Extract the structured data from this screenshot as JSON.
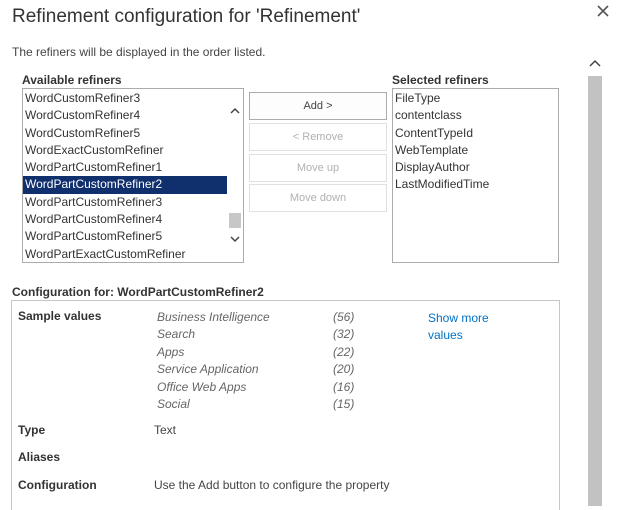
{
  "dialog": {
    "title": "Refinement configuration for 'Refinement'",
    "intro": "The refiners will be displayed in the order listed."
  },
  "available": {
    "label": "Available refiners",
    "items": [
      "WordCustomRefiner3",
      "WordCustomRefiner4",
      "WordCustomRefiner5",
      "WordExactCustomRefiner",
      "WordPartCustomRefiner1",
      "WordPartCustomRefiner2",
      "WordPartCustomRefiner3",
      "WordPartCustomRefiner4",
      "WordPartCustomRefiner5",
      "WordPartExactCustomRefiner"
    ],
    "selected": "WordPartCustomRefiner2"
  },
  "selected_refiners": {
    "label": "Selected refiners",
    "items": [
      "FileType",
      "contentclass",
      "ContentTypeId",
      "WebTemplate",
      "DisplayAuthor",
      "LastModifiedTime"
    ]
  },
  "buttons": {
    "add": "Add >",
    "remove": "< Remove",
    "move_up": "Move up",
    "move_down": "Move down"
  },
  "config": {
    "heading": "Configuration for: WordPartCustomRefiner2",
    "sample_values_label": "Sample values",
    "samples": [
      {
        "name": "Business Intelligence",
        "count": "(56)"
      },
      {
        "name": "Search",
        "count": "(32)"
      },
      {
        "name": "Apps",
        "count": "(22)"
      },
      {
        "name": "Service Application",
        "count": "(20)"
      },
      {
        "name": "Office Web Apps",
        "count": "(16)"
      },
      {
        "name": "Social",
        "count": "(15)"
      }
    ],
    "show_more": "Show more values",
    "type_label": "Type",
    "type_value": "Text",
    "aliases_label": "Aliases",
    "configuration_label": "Configuration",
    "configuration_value": "Use the Add button to configure the property"
  },
  "colors": {
    "selection": "#0f2f6d",
    "link": "#0072c6"
  }
}
